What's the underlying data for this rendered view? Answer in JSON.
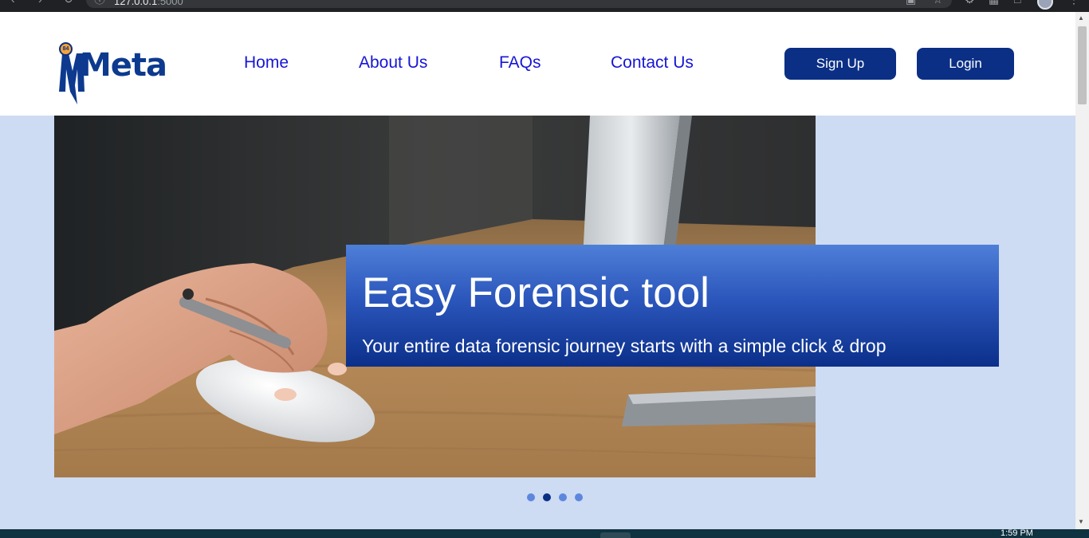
{
  "browser": {
    "url_host": "127.0.0.1",
    "url_port": ":5000"
  },
  "header": {
    "brand": "Meta",
    "badge": "84",
    "nav": [
      "Home",
      "About Us",
      "FAQs",
      "Contact Us"
    ],
    "signup_label": "Sign Up",
    "login_label": "Login"
  },
  "hero": {
    "title": "Easy Forensic tool",
    "subtitle": "Your entire data forensic journey starts with a simple click & drop",
    "slide_count": 4,
    "active_slide": 2
  },
  "taskbar": {
    "time": "1:59 PM"
  },
  "colors": {
    "primary": "#0a2f85",
    "nav_link": "#1616d6",
    "page_bg": "#cddbf3",
    "dot_inactive": "#5c87dc"
  }
}
